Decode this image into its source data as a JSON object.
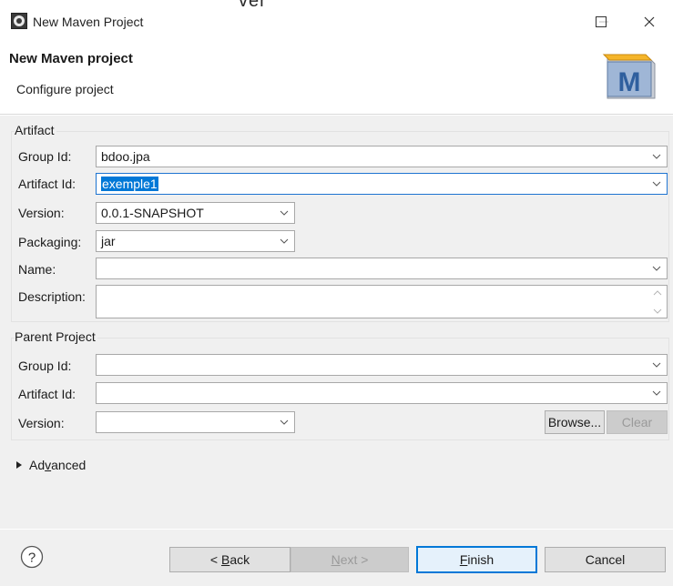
{
  "window": {
    "title": "New Maven Project"
  },
  "header": {
    "title": "New Maven project",
    "subtitle": "Configure project",
    "logo_text": "M"
  },
  "artifact": {
    "group_label": "Artifact",
    "group_id": {
      "label": "Group Id:",
      "value": "bdoo.jpa"
    },
    "artifact_id": {
      "label": "Artifact Id:",
      "value": "exemple1"
    },
    "version": {
      "label": "Version:",
      "value": "0.0.1-SNAPSHOT"
    },
    "packaging": {
      "label": "Packaging:",
      "value": "jar"
    },
    "name": {
      "label": "Name:",
      "value": ""
    },
    "description": {
      "label": "Description:",
      "value": ""
    }
  },
  "parent": {
    "group_label": "Parent Project",
    "group_id": {
      "label": "Group Id:",
      "value": ""
    },
    "artifact_id": {
      "label": "Artifact Id:",
      "value": ""
    },
    "version": {
      "label": "Version:",
      "value": ""
    },
    "browse_label": "Browse...",
    "clear_label": "Clear"
  },
  "advanced": {
    "label_pre": "Ad",
    "label_u": "v",
    "label_post": "anced",
    "expanded": false
  },
  "buttons": {
    "back": {
      "pre": "< ",
      "u": "B",
      "post": "ack"
    },
    "next": {
      "pre": "",
      "u": "N",
      "post": "ext >"
    },
    "finish": {
      "pre": "",
      "u": "F",
      "post": "inish"
    },
    "cancel": "Cancel"
  },
  "colors": {
    "selection": "#0078d7",
    "focus_border": "#1e74d1",
    "dialog_bg": "#f0f0f0"
  }
}
